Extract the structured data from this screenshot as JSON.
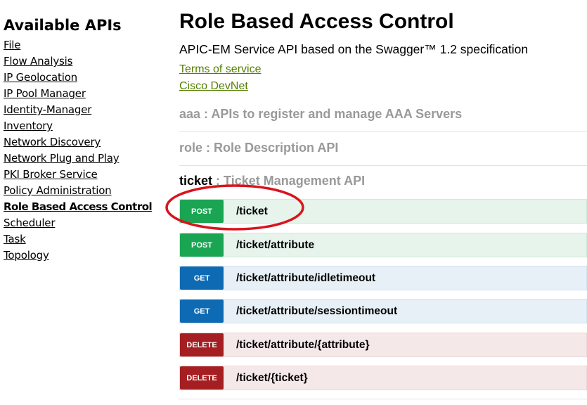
{
  "sidebar": {
    "heading": "Available APIs",
    "items": [
      {
        "label": "File"
      },
      {
        "label": "Flow Analysis"
      },
      {
        "label": "IP Geolocation"
      },
      {
        "label": "IP Pool Manager"
      },
      {
        "label": "Identity-Manager"
      },
      {
        "label": "Inventory"
      },
      {
        "label": "Network Discovery"
      },
      {
        "label": "Network Plug and Play"
      },
      {
        "label": "PKI Broker Service"
      },
      {
        "label": "Policy Administration"
      },
      {
        "label": "Role Based Access Control",
        "active": true
      },
      {
        "label": "Scheduler"
      },
      {
        "label": "Task"
      },
      {
        "label": "Topology"
      }
    ]
  },
  "main": {
    "title": "Role Based Access Control",
    "subtitle": "APIC-EM Service API based on the Swagger™ 1.2 specification",
    "links": {
      "terms": "Terms of service",
      "devnet": "Cisco DevNet"
    },
    "groups": [
      {
        "name": "aaa",
        "separator": " : ",
        "description": "APIs to register and manage AAA Servers"
      },
      {
        "name": "role",
        "separator": " : ",
        "description": "Role Description API"
      },
      {
        "name": "ticket",
        "separator": " : ",
        "description": "Ticket Management API"
      }
    ],
    "operations": [
      {
        "method": "POST",
        "path": "/ticket"
      },
      {
        "method": "POST",
        "path": "/ticket/attribute"
      },
      {
        "method": "GET",
        "path": "/ticket/attribute/idletimeout"
      },
      {
        "method": "GET",
        "path": "/ticket/attribute/sessiontimeout"
      },
      {
        "method": "DELETE",
        "path": "/ticket/attribute/{attribute}"
      },
      {
        "method": "DELETE",
        "path": "/ticket/{ticket}"
      }
    ]
  },
  "colors": {
    "post": "#1aa553",
    "get": "#0f6ab4",
    "delete": "#a41e22",
    "link": "#547f00",
    "annotation": "#d9141c"
  }
}
